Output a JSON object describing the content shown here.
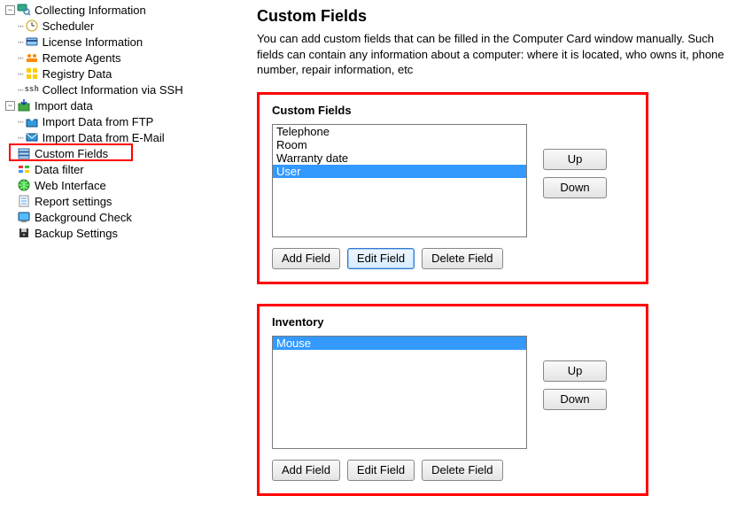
{
  "sidebar": {
    "items": [
      {
        "label": "Collecting Information",
        "collapsible": true,
        "expanded": true,
        "icon": "magnifier-pc-icon",
        "level": 1
      },
      {
        "label": "Scheduler",
        "icon": "clock-icon",
        "level": 2
      },
      {
        "label": "License Information",
        "icon": "card-icon",
        "level": 2
      },
      {
        "label": "Remote Agents",
        "icon": "agents-icon",
        "level": 2
      },
      {
        "label": "Registry Data",
        "icon": "registry-icon",
        "level": 2
      },
      {
        "label": "Collect Information via SSH",
        "icon": "ssh-icon",
        "level": 2
      },
      {
        "label": "Import data",
        "collapsible": true,
        "expanded": true,
        "icon": "import-icon",
        "level": 1
      },
      {
        "label": "Import Data from FTP",
        "icon": "ftp-icon",
        "level": 2
      },
      {
        "label": "Import Data from E-Mail",
        "icon": "email-icon",
        "level": 2
      },
      {
        "label": "Custom Fields",
        "icon": "fields-icon",
        "level": 1,
        "highlighted": true
      },
      {
        "label": "Data filter",
        "icon": "filter-icon",
        "level": 1
      },
      {
        "label": "Web Interface",
        "icon": "globe-icon",
        "level": 1
      },
      {
        "label": "Report settings",
        "icon": "report-icon",
        "level": 1
      },
      {
        "label": "Background Check",
        "icon": "bgcheck-icon",
        "level": 1
      },
      {
        "label": "Backup Settings",
        "icon": "backup-icon",
        "level": 1
      }
    ]
  },
  "page": {
    "title": "Custom Fields",
    "description": "You can add custom fields that can be filled in the Computer Card window manually. Such fields can contain any information about a computer: where it is located, who owns it, phone number, repair information, etc"
  },
  "groups": [
    {
      "title": "Custom Fields",
      "items": [
        "Telephone",
        "Room",
        "Warranty date",
        "User"
      ],
      "selected_index": 3,
      "buttons": {
        "up": "Up",
        "down": "Down",
        "add": "Add Field",
        "edit": "Edit Field",
        "delete": "Delete Field"
      },
      "edit_focused": true
    },
    {
      "title": "Inventory",
      "items": [
        "Mouse"
      ],
      "selected_index": 0,
      "buttons": {
        "up": "Up",
        "down": "Down",
        "add": "Add Field",
        "edit": "Edit Field",
        "delete": "Delete Field"
      },
      "edit_focused": false
    }
  ]
}
